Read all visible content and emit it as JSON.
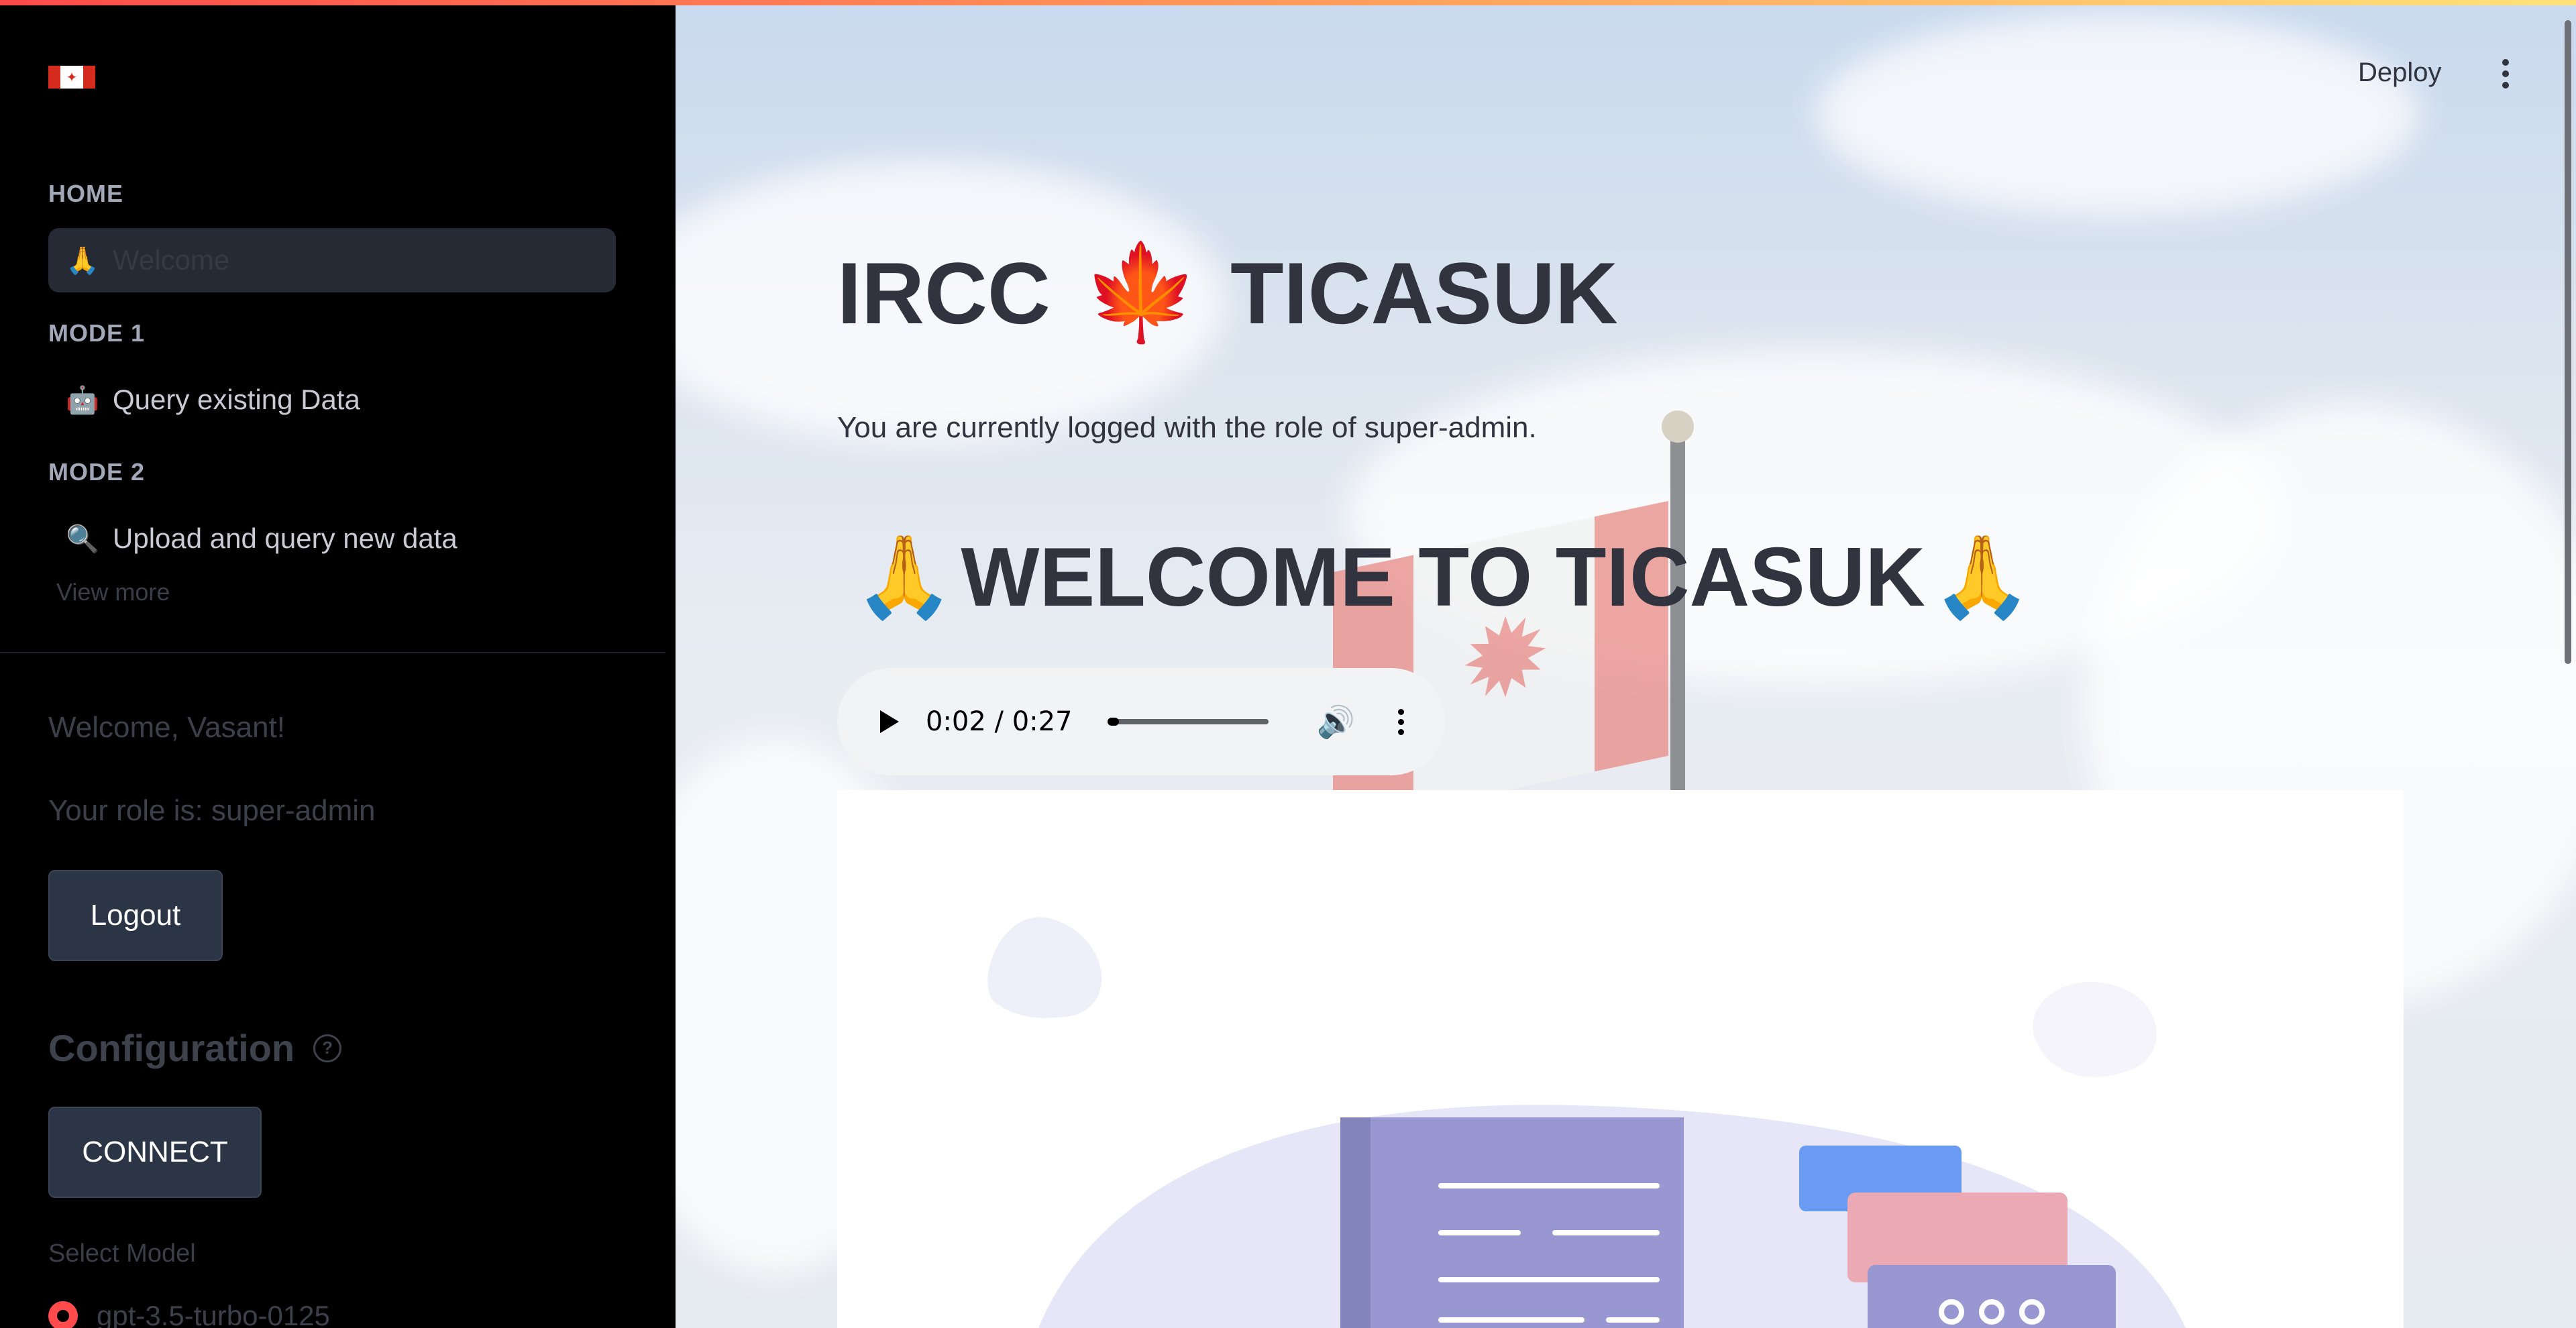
{
  "app": {
    "accent_gradient": [
      "#ff4b4b",
      "#ffe27a"
    ]
  },
  "sidebar": {
    "logo_icon": "canada-flag-icon",
    "sections": [
      {
        "title": "HOME",
        "items": [
          {
            "icon": "🙏",
            "label": "Welcome",
            "active": true
          }
        ]
      },
      {
        "title": "MODE 1",
        "items": [
          {
            "icon": "🤖",
            "label": "Query existing Data"
          }
        ]
      },
      {
        "title": "MODE 2",
        "items": [
          {
            "icon": "🔍",
            "label": "Upload and query new data"
          }
        ]
      }
    ],
    "view_more": "View more",
    "welcome_text": "Welcome, Vasant!",
    "role_text": "Your role is: super-admin",
    "logout_label": "Logout",
    "config_title": "Configuration",
    "help_icon": "?",
    "connect_label": "CONNECT",
    "select_model_label": "Select Model",
    "model_option": "gpt-3.5-turbo-0125"
  },
  "header": {
    "deploy_label": "Deploy",
    "menu_icon": "kebab-menu-icon"
  },
  "main": {
    "title_left": "IRCC",
    "title_emoji": "🍁",
    "title_right": "TICASUK",
    "subtext": "You are currently logged with the role of super-admin.",
    "welcome_emoji": "🙏",
    "welcome_heading": "WELCOME TO TICASUK",
    "audio": {
      "time": "0:02 / 0:27",
      "progress": 0.074
    }
  }
}
